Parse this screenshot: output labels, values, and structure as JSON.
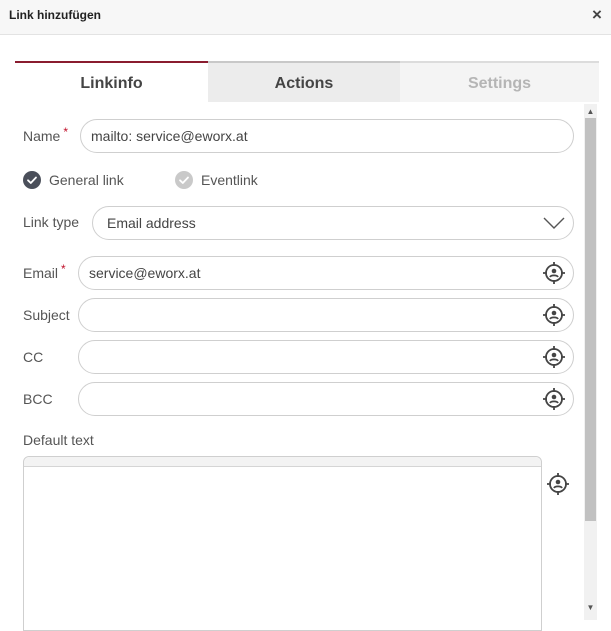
{
  "dialog": {
    "title": "Link hinzufügen",
    "close": "×"
  },
  "tabs": [
    {
      "label": "Linkinfo",
      "state": "active"
    },
    {
      "label": "Actions",
      "state": "enabled"
    },
    {
      "label": "Settings",
      "state": "disabled"
    }
  ],
  "form": {
    "name": {
      "label": "Name",
      "required": "*",
      "value": "mailto: service@eworx.at"
    },
    "link_kind": {
      "options": [
        {
          "label": "General link",
          "selected": true
        },
        {
          "label": "Eventlink",
          "selected": false
        }
      ]
    },
    "link_type": {
      "label": "Link type",
      "value": "Email address"
    },
    "email": {
      "label": "Email",
      "required": "*",
      "value": "service@eworx.at"
    },
    "subject": {
      "label": "Subject",
      "value": ""
    },
    "cc": {
      "label": "CC",
      "value": ""
    },
    "bcc": {
      "label": "BCC",
      "value": ""
    },
    "default_text": {
      "label": "Default text",
      "value": ""
    }
  },
  "icons": {
    "placeholder_picker": "crosshair-person-icon",
    "dropdown": "chevron-down-icon",
    "radio_selected": "check-circle-icon"
  },
  "colors": {
    "accent": "#8a1c2f",
    "required": "#c0102a",
    "radio_checked": "#4a4f5a",
    "radio_unchecked": "#c9c9c9"
  }
}
